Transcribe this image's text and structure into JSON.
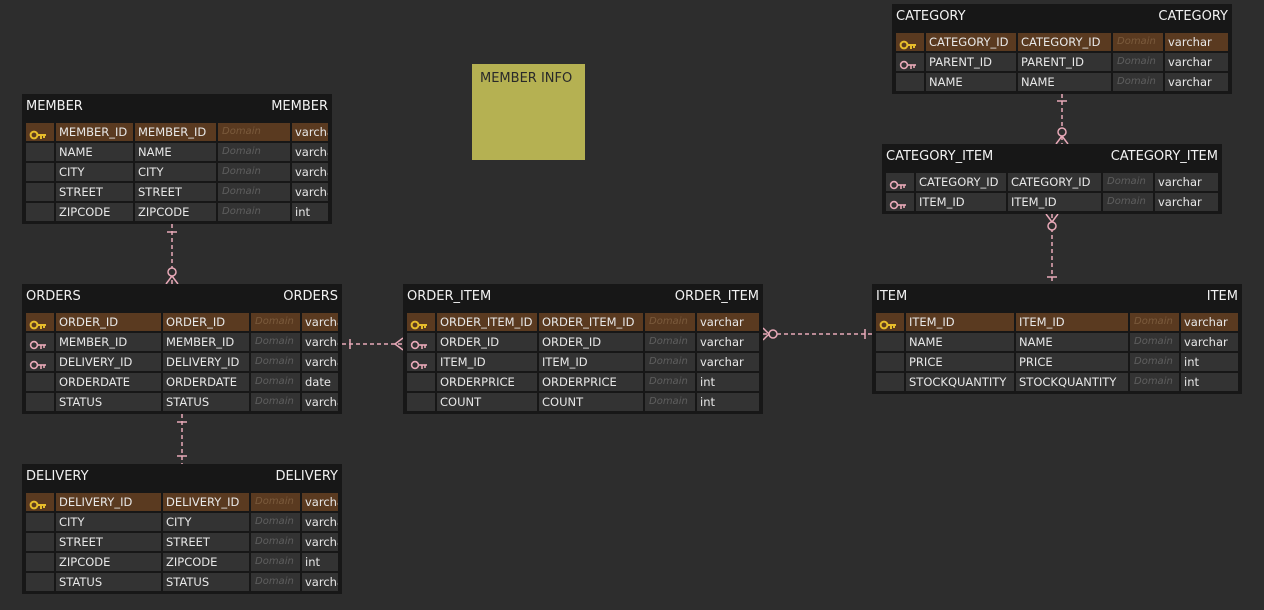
{
  "colors": {
    "background": "#2d2d2d",
    "entity": "#171717",
    "cell": "#333333",
    "pk_row": "#5a3a20",
    "pk_key": "#e8bd2b",
    "fk_key": "#e8a9b8",
    "relationship": "#e8a9b8",
    "note": "#b5b152"
  },
  "note": {
    "text": "MEMBER INFO"
  },
  "entities": {
    "member": {
      "logical_name": "MEMBER",
      "physical_name": "MEMBER",
      "columns": [
        {
          "logical": "MEMBER_ID",
          "physical": "MEMBER_ID",
          "domain": "Domain",
          "type": "varchar",
          "key": "pk"
        },
        {
          "logical": "NAME",
          "physical": "NAME",
          "domain": "Domain",
          "type": "varchar",
          "key": ""
        },
        {
          "logical": "CITY",
          "physical": "CITY",
          "domain": "Domain",
          "type": "varchar",
          "key": ""
        },
        {
          "logical": "STREET",
          "physical": "STREET",
          "domain": "Domain",
          "type": "varchar",
          "key": ""
        },
        {
          "logical": "ZIPCODE",
          "physical": "ZIPCODE",
          "domain": "Domain",
          "type": "int",
          "key": ""
        }
      ]
    },
    "orders": {
      "logical_name": "ORDERS",
      "physical_name": "ORDERS",
      "columns": [
        {
          "logical": "ORDER_ID",
          "physical": "ORDER_ID",
          "domain": "Domain",
          "type": "varchar",
          "key": "pk"
        },
        {
          "logical": "MEMBER_ID",
          "physical": "MEMBER_ID",
          "domain": "Domain",
          "type": "varchar",
          "key": "fk"
        },
        {
          "logical": "DELIVERY_ID",
          "physical": "DELIVERY_ID",
          "domain": "Domain",
          "type": "varchar",
          "key": "fk"
        },
        {
          "logical": "ORDERDATE",
          "physical": "ORDERDATE",
          "domain": "Domain",
          "type": "date",
          "key": ""
        },
        {
          "logical": "STATUS",
          "physical": "STATUS",
          "domain": "Domain",
          "type": "varchar",
          "key": ""
        }
      ]
    },
    "delivery": {
      "logical_name": "DELIVERY",
      "physical_name": "DELIVERY",
      "columns": [
        {
          "logical": "DELIVERY_ID",
          "physical": "DELIVERY_ID",
          "domain": "Domain",
          "type": "varchar",
          "key": "pk"
        },
        {
          "logical": "CITY",
          "physical": "CITY",
          "domain": "Domain",
          "type": "varchar",
          "key": ""
        },
        {
          "logical": "STREET",
          "physical": "STREET",
          "domain": "Domain",
          "type": "varchar",
          "key": ""
        },
        {
          "logical": "ZIPCODE",
          "physical": "ZIPCODE",
          "domain": "Domain",
          "type": "int",
          "key": ""
        },
        {
          "logical": "STATUS",
          "physical": "STATUS",
          "domain": "Domain",
          "type": "varchar",
          "key": ""
        }
      ]
    },
    "order_item": {
      "logical_name": "ORDER_ITEM",
      "physical_name": "ORDER_ITEM",
      "columns": [
        {
          "logical": "ORDER_ITEM_ID",
          "physical": "ORDER_ITEM_ID",
          "domain": "Domain",
          "type": "varchar",
          "key": "pk"
        },
        {
          "logical": "ORDER_ID",
          "physical": "ORDER_ID",
          "domain": "Domain",
          "type": "varchar",
          "key": "fk"
        },
        {
          "logical": "ITEM_ID",
          "physical": "ITEM_ID",
          "domain": "Domain",
          "type": "varchar",
          "key": "fk"
        },
        {
          "logical": "ORDERPRICE",
          "physical": "ORDERPRICE",
          "domain": "Domain",
          "type": "int",
          "key": ""
        },
        {
          "logical": "COUNT",
          "physical": "COUNT",
          "domain": "Domain",
          "type": "int",
          "key": ""
        }
      ]
    },
    "item": {
      "logical_name": "ITEM",
      "physical_name": "ITEM",
      "columns": [
        {
          "logical": "ITEM_ID",
          "physical": "ITEM_ID",
          "domain": "Domain",
          "type": "varchar",
          "key": "pk"
        },
        {
          "logical": "NAME",
          "physical": "NAME",
          "domain": "Domain",
          "type": "varchar",
          "key": ""
        },
        {
          "logical": "PRICE",
          "physical": "PRICE",
          "domain": "Domain",
          "type": "int",
          "key": ""
        },
        {
          "logical": "STOCKQUANTITY",
          "physical": "STOCKQUANTITY",
          "domain": "Domain",
          "type": "int",
          "key": ""
        }
      ]
    },
    "category": {
      "logical_name": "CATEGORY",
      "physical_name": "CATEGORY",
      "columns": [
        {
          "logical": "CATEGORY_ID",
          "physical": "CATEGORY_ID",
          "domain": "Domain",
          "type": "varchar",
          "key": "pk"
        },
        {
          "logical": "PARENT_ID",
          "physical": "PARENT_ID",
          "domain": "Domain",
          "type": "varchar",
          "key": "fk"
        },
        {
          "logical": "NAME",
          "physical": "NAME",
          "domain": "Domain",
          "type": "varchar",
          "key": ""
        }
      ]
    },
    "category_item": {
      "logical_name": "CATEGORY_ITEM",
      "physical_name": "CATEGORY_ITEM",
      "columns": [
        {
          "logical": "CATEGORY_ID",
          "physical": "CATEGORY_ID",
          "domain": "Domain",
          "type": "varchar",
          "key": "fk"
        },
        {
          "logical": "ITEM_ID",
          "physical": "ITEM_ID",
          "domain": "Domain",
          "type": "varchar",
          "key": "fk"
        }
      ]
    }
  },
  "relationships": [
    {
      "from": "member",
      "to": "orders",
      "parent_end": "one",
      "child_end": "zero-or-many"
    },
    {
      "from": "delivery",
      "to": "orders",
      "parent_end": "one",
      "child_end": "one"
    },
    {
      "from": "orders",
      "to": "order_item",
      "parent_end": "one",
      "child_end": "many"
    },
    {
      "from": "item",
      "to": "order_item",
      "parent_end": "one",
      "child_end": "zero-or-many"
    },
    {
      "from": "category",
      "to": "category_item",
      "parent_end": "one",
      "child_end": "zero-or-many"
    },
    {
      "from": "item",
      "to": "category_item",
      "parent_end": "one",
      "child_end": "zero-or-many"
    }
  ]
}
